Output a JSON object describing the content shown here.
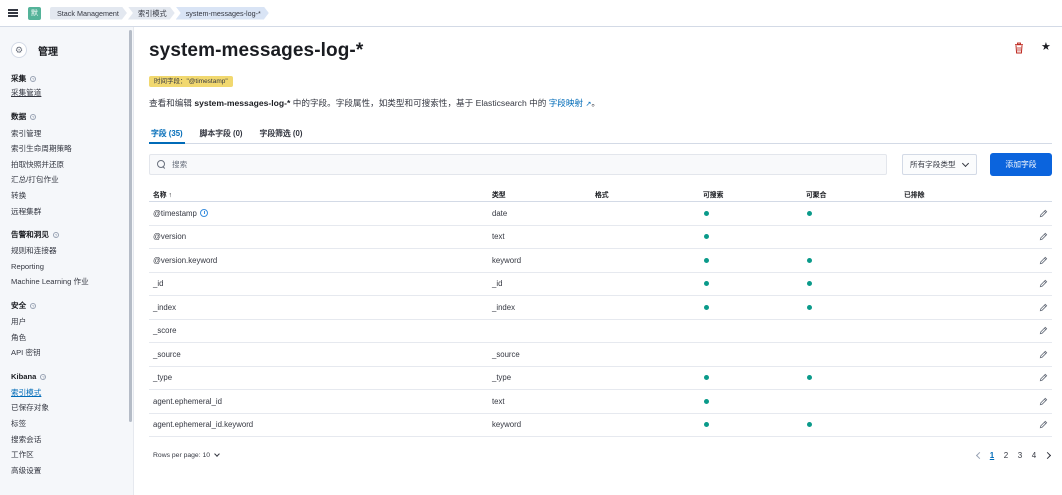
{
  "header": {
    "space_initial": "默",
    "breadcrumbs": [
      "Stack Management",
      "索引模式",
      "system-messages-log-*"
    ]
  },
  "sidebar": {
    "title": "管理",
    "groups": [
      {
        "title": "采集",
        "items": [
          "采集管道"
        ]
      },
      {
        "title": "数据",
        "items": [
          "索引管理",
          "索引生命周期策略",
          "拍取快照并还原",
          "汇总/打包作业",
          "转换",
          "远程集群"
        ]
      },
      {
        "title": "告警和洞见",
        "items": [
          "规则和连接器",
          "Reporting",
          "Machine Learning 作业"
        ]
      },
      {
        "title": "安全",
        "items": [
          "用户",
          "角色",
          "API 密钥"
        ]
      },
      {
        "title": "Kibana",
        "items": [
          "索引模式",
          "已保存对象",
          "标签",
          "搜索会话",
          "工作区",
          "高级设置"
        ]
      }
    ]
  },
  "main": {
    "title": "system-messages-log-*",
    "time_field_badge": "时间字段：\"@timestamp\"",
    "description": {
      "prefix": "查看和编辑 ",
      "bold": "system-messages-log-*",
      "middle": " 中的字段。字段属性，如类型和可搜索性，基于 Elasticsearch 中的 ",
      "link": "字段映射",
      "suffix": "。"
    },
    "tabs": [
      "字段 (35)",
      "脚本字段 (0)",
      "字段筛选 (0)"
    ],
    "search_placeholder": "搜索",
    "type_filter_label": "所有字段类型",
    "add_field_label": "添加字段",
    "columns": {
      "name": "名称 ↑",
      "type": "类型",
      "format": "格式",
      "searchable": "可搜索",
      "aggregatable": "可聚合",
      "excluded": "已排除"
    },
    "rows": [
      {
        "name": "@timestamp",
        "type": "date",
        "searchable": true,
        "aggregatable": true,
        "is_time": true
      },
      {
        "name": "@version",
        "type": "text",
        "searchable": true,
        "aggregatable": false
      },
      {
        "name": "@version.keyword",
        "type": "keyword",
        "searchable": true,
        "aggregatable": true
      },
      {
        "name": "_id",
        "type": "_id",
        "searchable": true,
        "aggregatable": true
      },
      {
        "name": "_index",
        "type": "_index",
        "searchable": true,
        "aggregatable": true
      },
      {
        "name": "_score",
        "type": "",
        "searchable": false,
        "aggregatable": false
      },
      {
        "name": "_source",
        "type": "_source",
        "searchable": false,
        "aggregatable": false
      },
      {
        "name": "_type",
        "type": "_type",
        "searchable": true,
        "aggregatable": true
      },
      {
        "name": "agent.ephemeral_id",
        "type": "text",
        "searchable": true,
        "aggregatable": false
      },
      {
        "name": "agent.ephemeral_id.keyword",
        "type": "keyword",
        "searchable": true,
        "aggregatable": true
      }
    ],
    "rows_per_page": "Rows per page: 10",
    "pages": [
      "1",
      "2",
      "3",
      "4"
    ],
    "current_page": "1"
  },
  "colors": {
    "accent": "#006bb8",
    "primary_button": "#0b64dd",
    "dot": "#0a9a8a",
    "badge": "#f1d86f",
    "delete": "#bd271e"
  }
}
